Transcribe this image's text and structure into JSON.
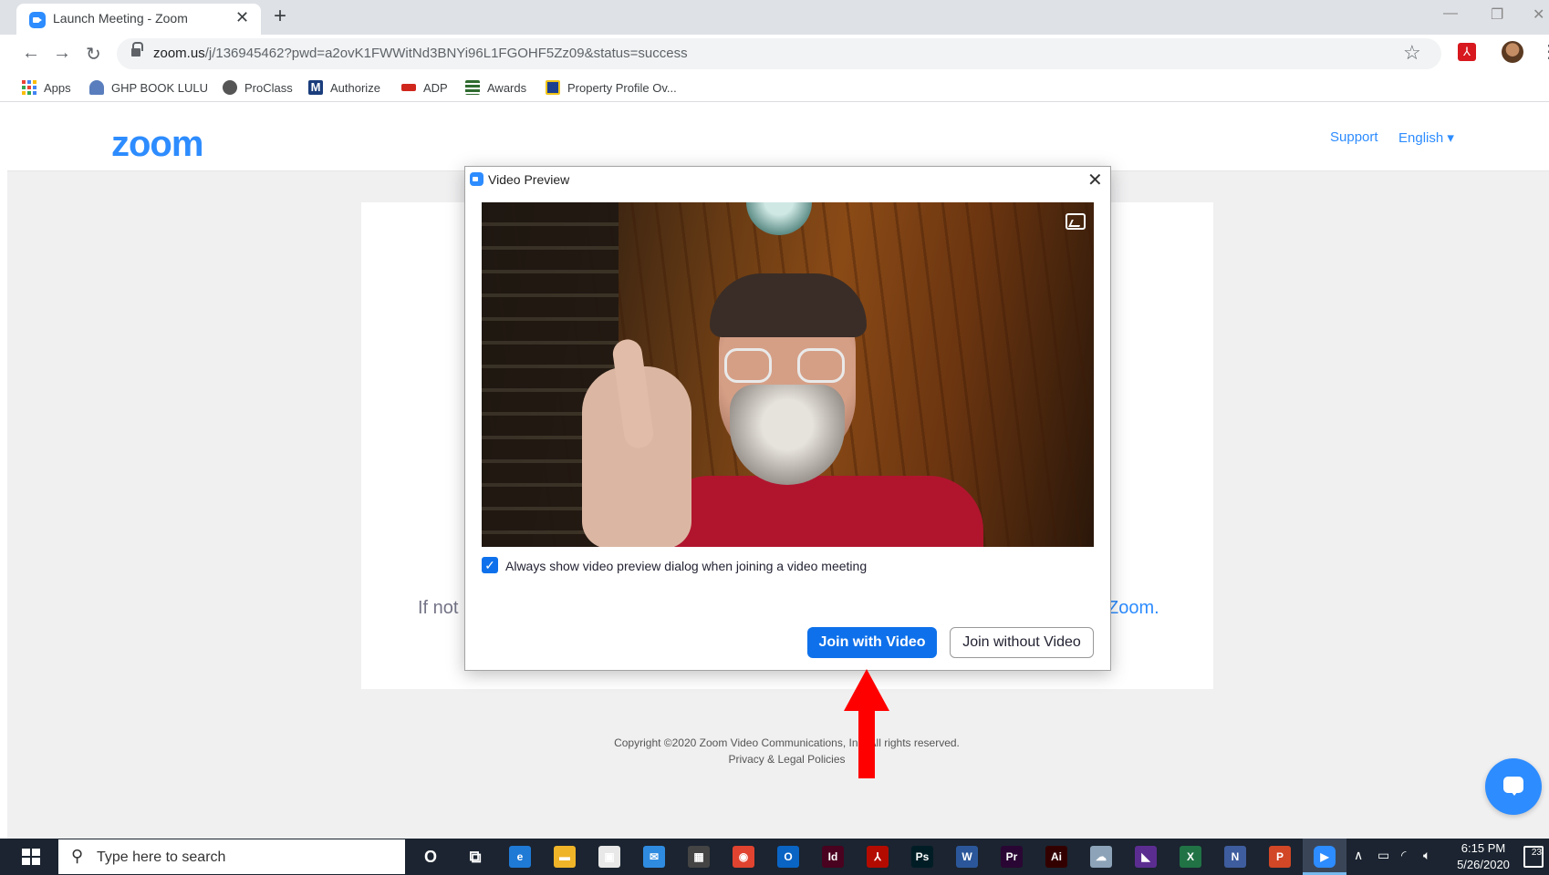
{
  "browser": {
    "tab_title": "Launch Meeting - Zoom",
    "tab_close": "✕",
    "new_tab": "+",
    "url_main": "zoom.us",
    "url_rest": "/j/136945462?pwd=a2ovK1FWWitNd3BNYi96L1FGOHF5Zz09&status=success",
    "minimize": "—",
    "restore": "❐",
    "close": "✕"
  },
  "bookmarks": [
    {
      "label": "Apps",
      "icon": "apps-grid-icon",
      "color": "#4285f4"
    },
    {
      "label": "GHP BOOK LULU",
      "icon": "lulu-icon",
      "color": "#5a7ebd"
    },
    {
      "label": "ProClass",
      "icon": "globe-icon",
      "color": "#555555"
    },
    {
      "label": "Authorize",
      "icon": "m-logo-icon",
      "color": "#1a3d7c"
    },
    {
      "label": "ADP",
      "icon": "adp-icon",
      "color": "#d0271d"
    },
    {
      "label": "Awards",
      "icon": "stack-icon",
      "color": "#2f6b2f"
    },
    {
      "label": "Property Profile Ov...",
      "icon": "doe-icon",
      "color": "#1d3f8f"
    }
  ],
  "zoom_header": {
    "logo": "zoom",
    "support": "Support",
    "language": "English ▾"
  },
  "page": {
    "card_text_left": "If not",
    "card_text_right": "Zoom.",
    "copyright": "Copyright ©2020 Zoom Video Communications, Inc. All rights reserved.",
    "privacy": "Privacy & Legal Policies"
  },
  "dialog": {
    "title": "Video Preview",
    "close": "✕",
    "checkbox_checked": true,
    "checkbox_mark": "✓",
    "checkbox_label": "Always show video preview dialog when joining a video meeting",
    "join_with_video": "Join with Video",
    "join_without_video": "Join without Video"
  },
  "taskbar": {
    "search_placeholder": "Type here to search",
    "time": "6:15 PM",
    "date": "5/26/2020",
    "notification_count": "23",
    "apps": [
      {
        "name": "cortana-icon",
        "glyph": "O",
        "color": "transparent"
      },
      {
        "name": "task-view-icon",
        "glyph": "⧉",
        "color": "transparent"
      },
      {
        "name": "edge-icon",
        "glyph": "e",
        "color": "#1f7ad6"
      },
      {
        "name": "file-explorer-icon",
        "glyph": "▬",
        "color": "#f0b429"
      },
      {
        "name": "store-icon",
        "glyph": "▣",
        "color": "#e8e8e8"
      },
      {
        "name": "mail-icon",
        "glyph": "✉",
        "color": "#2f8be0"
      },
      {
        "name": "calculator-icon",
        "glyph": "▦",
        "color": "#444444"
      },
      {
        "name": "chrome-icon",
        "glyph": "◉",
        "color": "#e0432f"
      },
      {
        "name": "outlook-icon",
        "glyph": "O",
        "color": "#0a64c4"
      },
      {
        "name": "indesign-icon",
        "glyph": "Id",
        "color": "#49021f"
      },
      {
        "name": "acrobat-icon",
        "glyph": "⅄",
        "color": "#b30b00"
      },
      {
        "name": "photoshop-icon",
        "glyph": "Ps",
        "color": "#001d26"
      },
      {
        "name": "word-icon",
        "glyph": "W",
        "color": "#2b579a"
      },
      {
        "name": "premiere-icon",
        "glyph": "Pr",
        "color": "#2a0634"
      },
      {
        "name": "illustrator-icon",
        "glyph": "Ai",
        "color": "#330000"
      },
      {
        "name": "network-app-icon",
        "glyph": "☁",
        "color": "#8da3b8"
      },
      {
        "name": "visual-studio-icon",
        "glyph": "◣",
        "color": "#5c2d91"
      },
      {
        "name": "excel-icon",
        "glyph": "X",
        "color": "#217346"
      },
      {
        "name": "publisher-icon",
        "glyph": "N",
        "color": "#3e5d9e"
      },
      {
        "name": "powerpoint-icon",
        "glyph": "P",
        "color": "#d24726"
      },
      {
        "name": "zoom-app-icon",
        "glyph": "▶",
        "color": "#2d8cff"
      }
    ]
  }
}
